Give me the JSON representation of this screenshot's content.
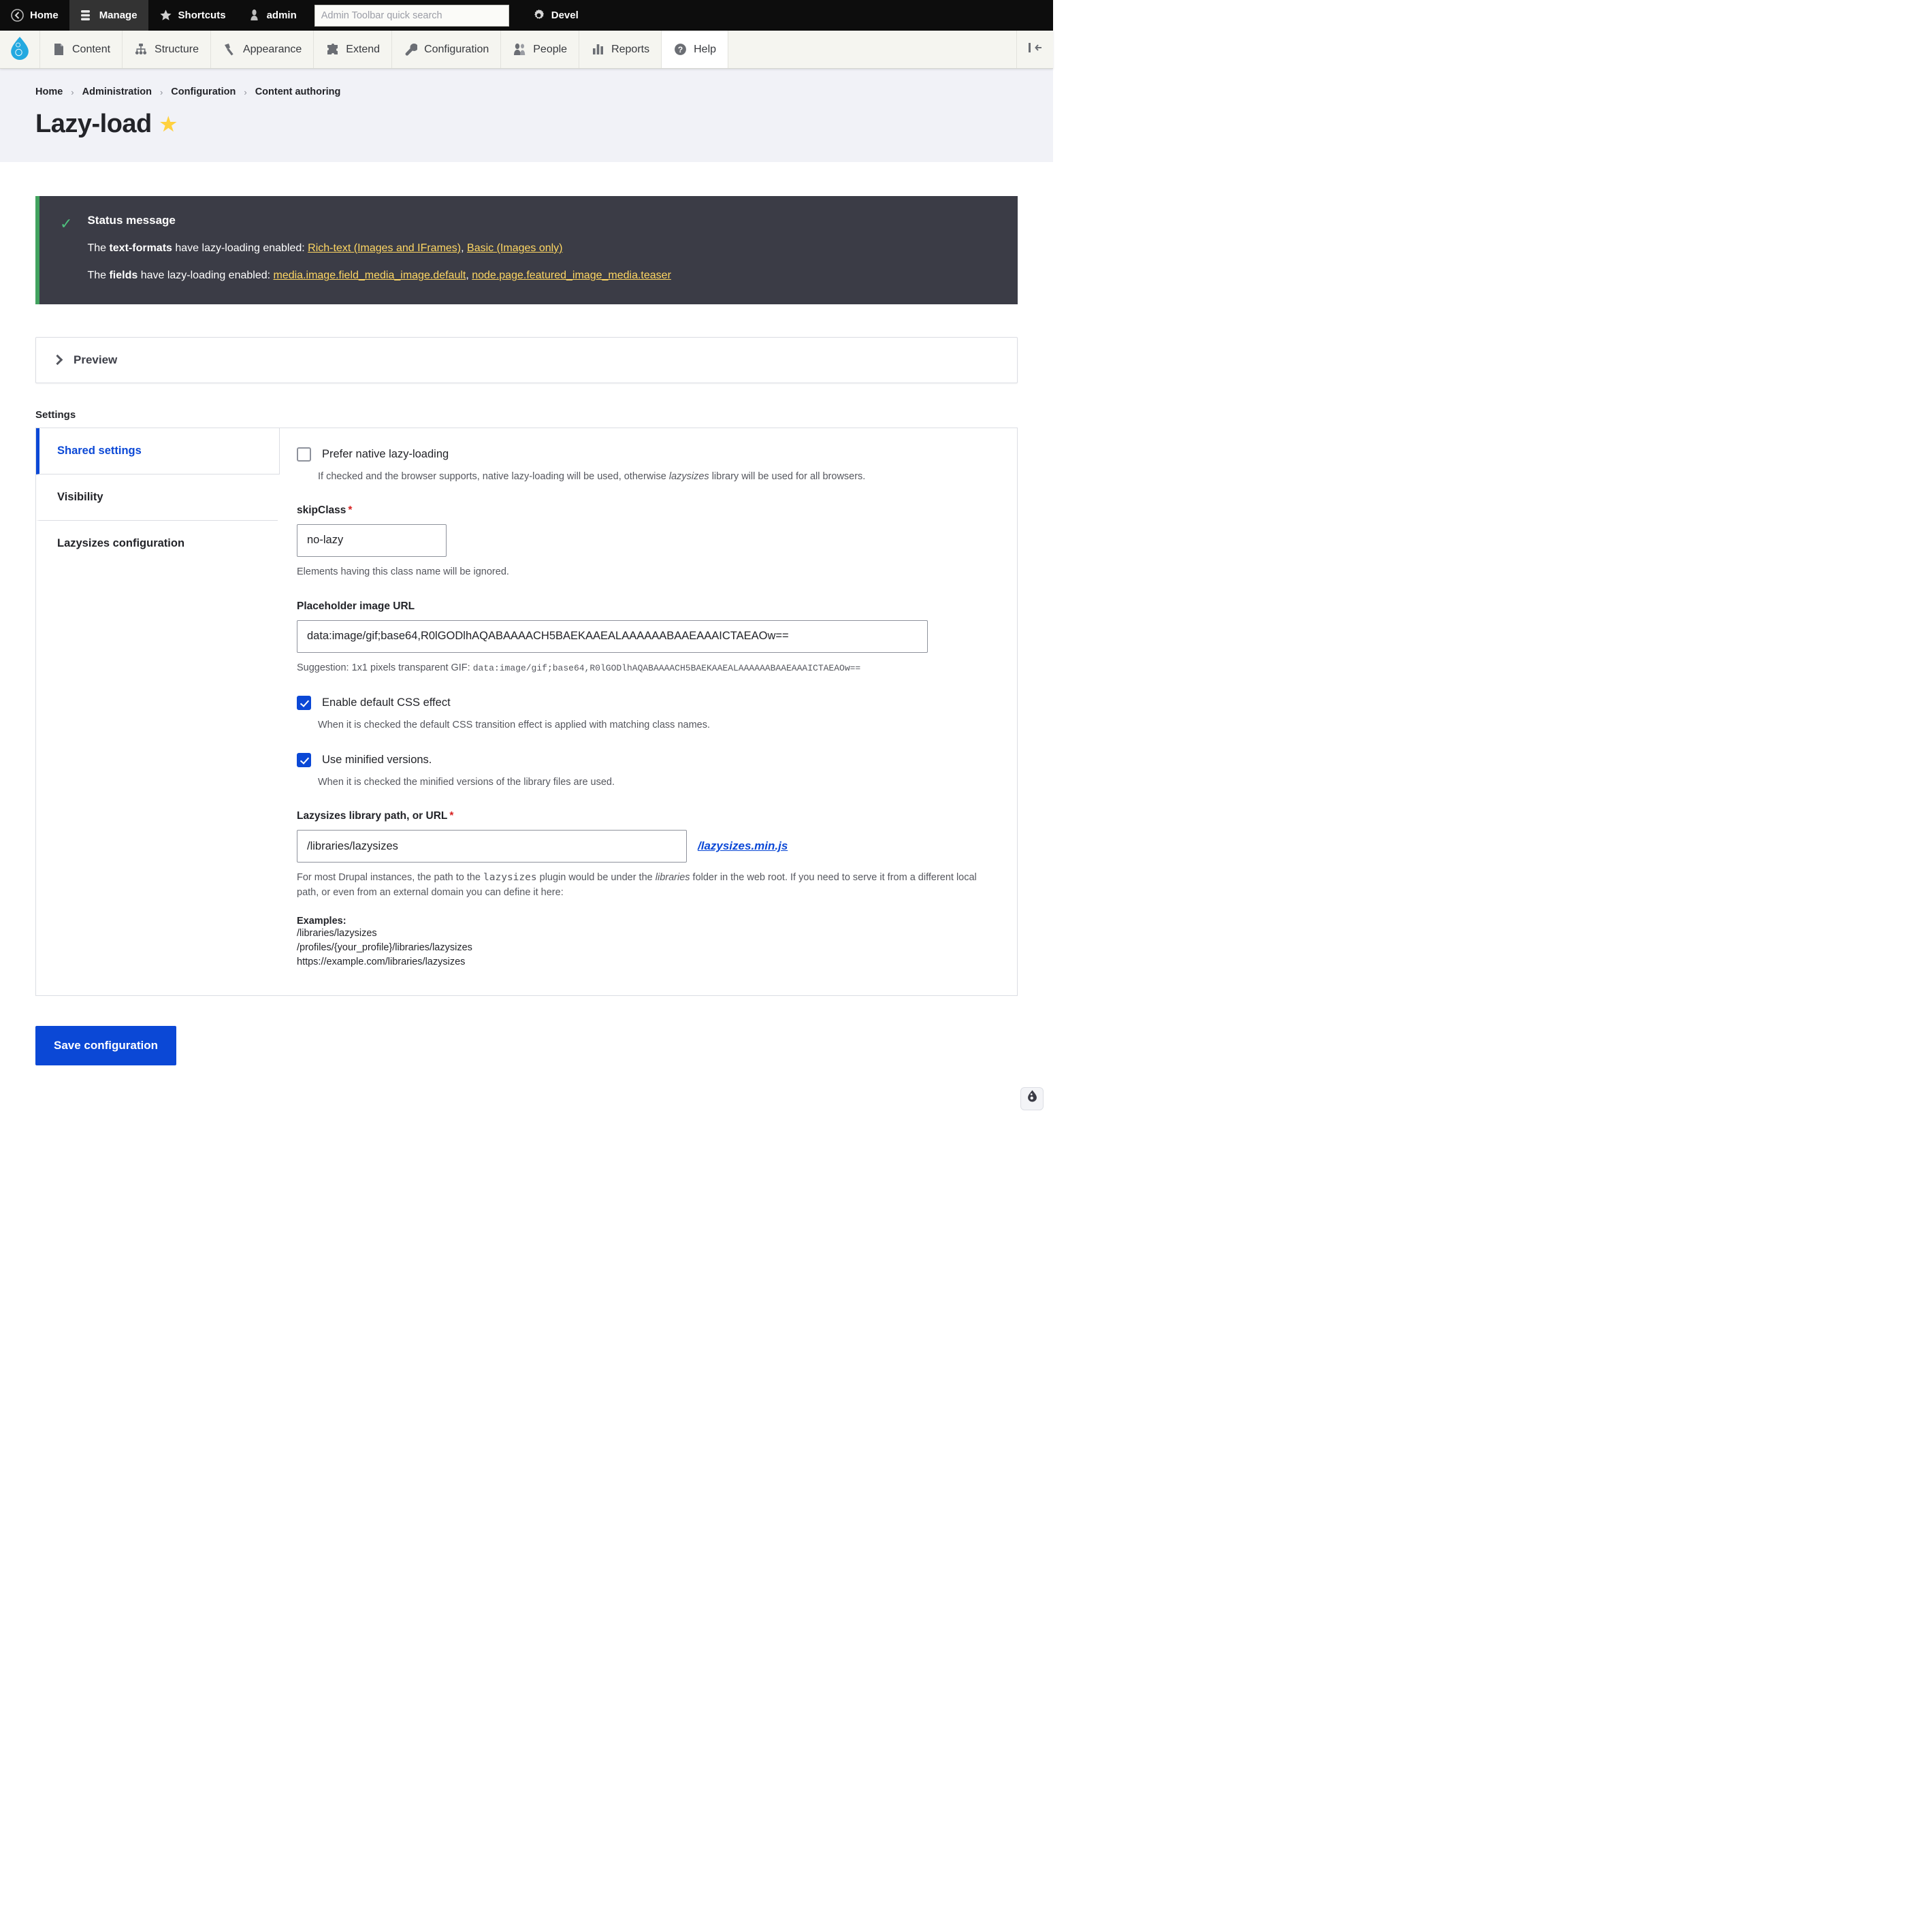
{
  "admin_bar": {
    "items": [
      {
        "label": "Home",
        "icon": "home-back-icon",
        "active": false
      },
      {
        "label": "Manage",
        "icon": "hamburger-icon",
        "active": true
      },
      {
        "label": "Shortcuts",
        "icon": "star-icon",
        "active": false
      },
      {
        "label": "admin",
        "icon": "user-icon",
        "active": false
      }
    ],
    "search_placeholder": "Admin Toolbar quick search",
    "search_value": "",
    "devel": {
      "label": "Devel",
      "icon": "gear-icon"
    }
  },
  "menu_bar": {
    "logo": "drupal-logo",
    "items": [
      {
        "label": "Content",
        "icon": "file-icon"
      },
      {
        "label": "Structure",
        "icon": "sitemap-icon"
      },
      {
        "label": "Appearance",
        "icon": "brush-icon"
      },
      {
        "label": "Extend",
        "icon": "puzzle-icon"
      },
      {
        "label": "Configuration",
        "icon": "wrench-icon"
      },
      {
        "label": "People",
        "icon": "people-icon"
      },
      {
        "label": "Reports",
        "icon": "bar-chart-icon"
      },
      {
        "label": "Help",
        "icon": "question-circle-icon"
      }
    ],
    "orientation_toggle": "toolbar-orientation-icon"
  },
  "breadcrumb": [
    {
      "label": "Home"
    },
    {
      "label": "Administration"
    },
    {
      "label": "Configuration"
    },
    {
      "label": "Content authoring"
    }
  ],
  "page": {
    "title": "Lazy-load",
    "star": "★"
  },
  "status_message": {
    "icon": "check-icon",
    "title": "Status message",
    "line1": {
      "prefix": "The ",
      "bold": "text-formats",
      "middle": " have lazy-loading enabled: ",
      "links": [
        "Rich-text (Images and IFrames)",
        "Basic (Images only)"
      ]
    },
    "line2": {
      "prefix": "The ",
      "bold": "fields",
      "middle": " have lazy-loading enabled: ",
      "links": [
        "media.image.field_media_image.default",
        "node.page.featured_image_media.teaser"
      ]
    },
    "accent_color": "#42a25f",
    "background_color": "#3b3c46",
    "link_color": "#ffd763"
  },
  "preview": {
    "summary": "Preview",
    "expanded": false
  },
  "settings": {
    "heading": "Settings",
    "tabs": [
      {
        "label": "Shared settings",
        "selected": true
      },
      {
        "label": "Visibility",
        "selected": false
      },
      {
        "label": "Lazysizes configuration",
        "selected": false
      }
    ]
  },
  "form": {
    "prefer_native": {
      "label": "Prefer native lazy-loading",
      "checked": false,
      "desc_pre": "If checked and the browser supports, native lazy-loading will be used, otherwise ",
      "desc_em": "lazysizes",
      "desc_post": " library will be used for all browsers."
    },
    "skip_class": {
      "label": "skipClass",
      "required": "*",
      "value": "no-lazy",
      "description": "Elements having this class name will be ignored."
    },
    "placeholder_url": {
      "label": "Placeholder image URL",
      "value": "data:image/gif;base64,R0lGODlhAQABAAAACH5BAEKAAEALAAAAAABAAEAAAICTAEAOw==",
      "suggestion_pre": "Suggestion: 1x1 pixels transparent GIF: ",
      "suggestion_code": "data:image/gif;base64,R0lGODlhAQABAAAACH5BAEKAAEALAAAAAABAAEAAAICTAEAOw=="
    },
    "css_effect": {
      "label": "Enable default CSS effect",
      "checked": true,
      "description": "When it is checked the default CSS transition effect is applied with matching class names."
    },
    "minified": {
      "label": "Use minified versions.",
      "checked": true,
      "description": "When it is checked the minified versions of the library files are used."
    },
    "library_path": {
      "label": "Lazysizes library path, or URL",
      "required": "*",
      "value": "/libraries/lazysizes",
      "link_text": "/lazysizes.min.js",
      "desc_a": "For most Drupal instances, the path to the ",
      "desc_code1": "lazysizes",
      "desc_b": " plugin would be under the ",
      "desc_em": "libraries",
      "desc_c": " folder in the web root. If you need to serve it from a different local path, or even from an external domain you can define it here:",
      "examples_title": "Examples:",
      "examples": [
        "/libraries/lazysizes",
        "/profiles/{your_profile}/libraries/lazysizes",
        "https://example.com/libraries/lazysizes"
      ]
    }
  },
  "actions": {
    "save_label": "Save configuration"
  },
  "colors": {
    "primary": "#0b48d6",
    "star": "#ffd13f",
    "required": "#d72222"
  }
}
